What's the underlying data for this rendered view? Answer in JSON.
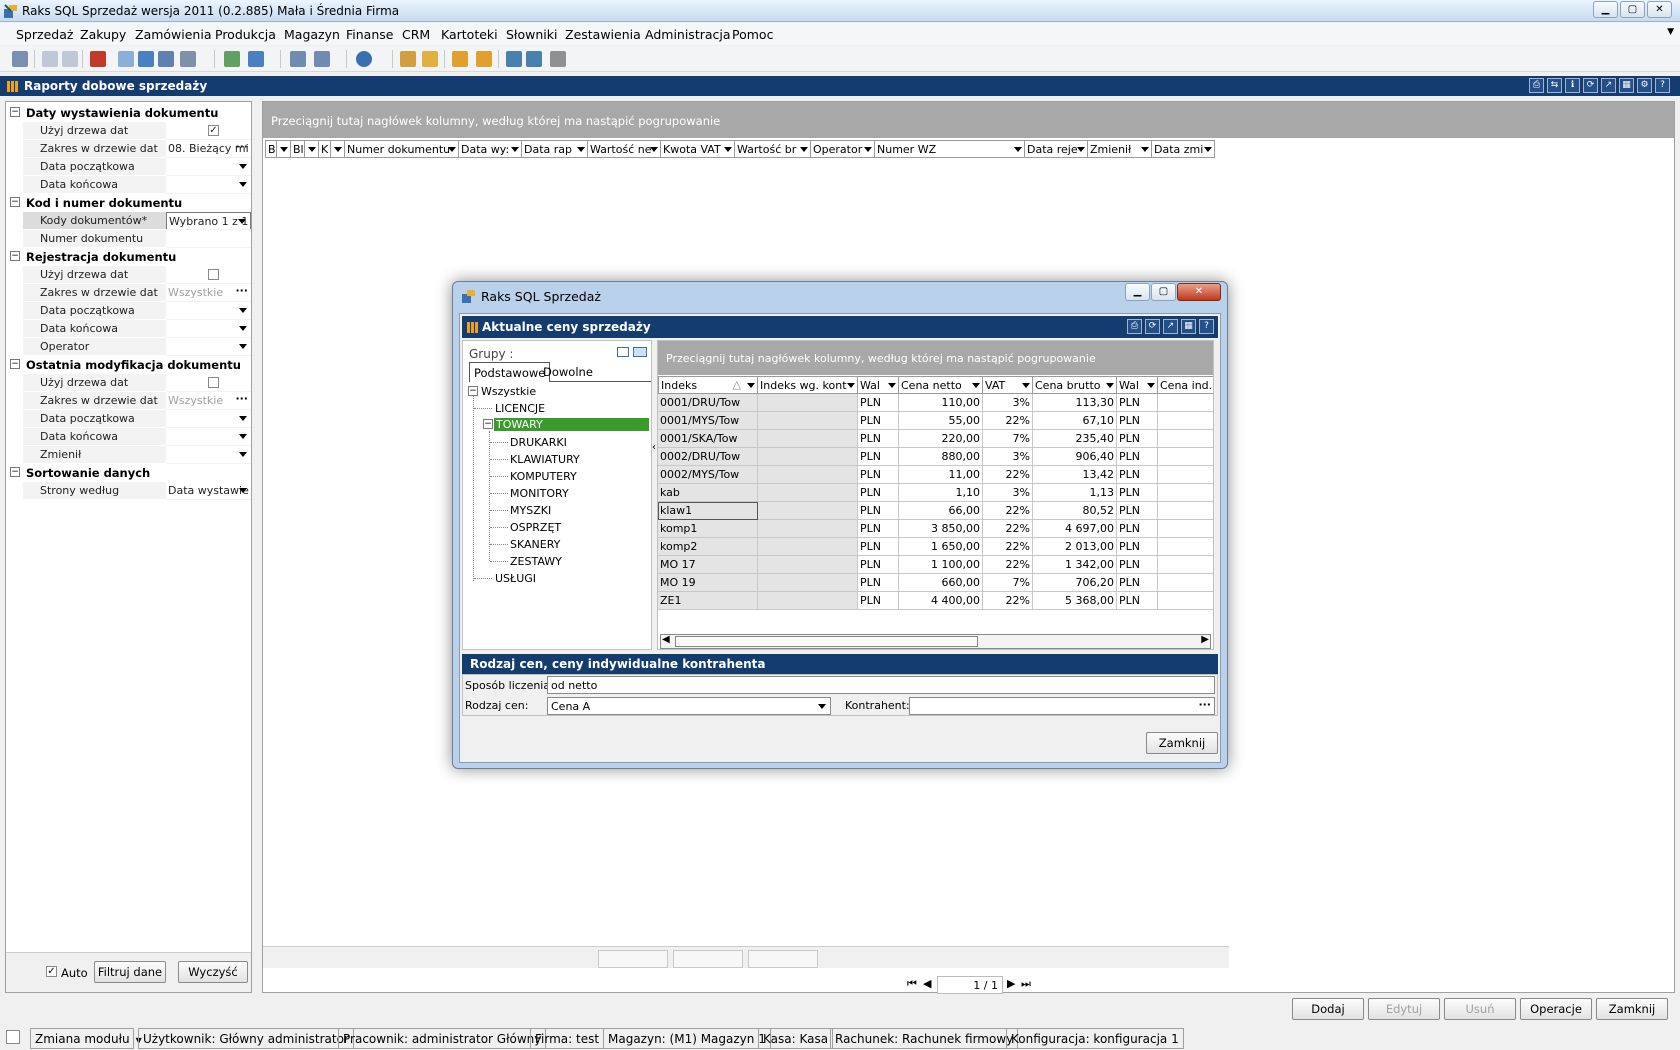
{
  "window": {
    "title": "Raks SQL Sprzedaż wersja 2011 (0.2.885) Mała i Średnia Firma",
    "buttons": [
      "▁",
      "▢",
      "✕"
    ]
  },
  "menu": [
    "Sprzedaż",
    "Zakupy",
    "Zamówienia",
    "Produkcja",
    "Magazyn",
    "Finanse",
    "CRM",
    "Kartoteki",
    "Słowniki",
    "Zestawienia",
    "Administracja",
    "Pomoc"
  ],
  "doc": {
    "title": "Raporty dobowe sprzedaży",
    "icons": [
      "⎙",
      "⇆",
      "ℹ",
      "⟳",
      "↗",
      "▦",
      "⚙",
      "?"
    ]
  },
  "filter": {
    "sections": {
      "s1": "Daty wystawienia dokumentu",
      "s2": "Kod i numer dokumentu",
      "s3": "Rejestracja dokumentu",
      "s4": "Ostatnia modyfikacja dokumentu",
      "s5": "Sortowanie danych"
    },
    "items": {
      "uzyj1": "Użyj drzewa dat",
      "zakres1": "Zakres w drzewie dat",
      "zakres1_val": "08. Bieżący mi",
      "datap1": "Data początkowa",
      "datak1": "Data końcowa",
      "kody": "Kody dokumentów*",
      "kody_val": "Wybrano 1 z 1",
      "numer": "Numer dokumentu",
      "uzyj2": "Użyj drzewa dat",
      "zakres2": "Zakres w drzewie dat",
      "zakres2_val": "Wszystkie",
      "datap2": "Data początkowa",
      "datak2": "Data końcowa",
      "operator": "Operator",
      "uzyj3": "Użyj drzewa dat",
      "zakres3": "Zakres w drzewie dat",
      "zakres3_val": "Wszystkie",
      "datap3": "Data początkowa",
      "datak3": "Data końcowa",
      "zmienil": "Zmienił",
      "strony": "Strony według",
      "strony_val": "Data wystawie"
    },
    "auto_label": "Auto",
    "filtruj_label": "Filtruj dane",
    "wyczysc_label": "Wyczyść"
  },
  "main": {
    "group_hint": "Przeciągnij tutaj nagłówek kolumny, według której ma nastąpić pogrupowanie",
    "columns": [
      "B",
      "Bl",
      "K",
      "Numer dokumentu",
      "Data wy:",
      "Data rap",
      "Wartość ne",
      "Kwota VAT",
      "Wartość br",
      "Operator",
      "Numer WZ",
      "Data reje",
      "Zmienił",
      "Data zmi"
    ],
    "pager": "1 / 1"
  },
  "actions": {
    "dodaj": "Dodaj",
    "edytuj": "Edytuj",
    "usun": "Usuń",
    "operacje": "Operacje",
    "zamknij": "Zamknij"
  },
  "status": {
    "modul": "Zmiana modułu",
    "uzytkownik": "Użytkownik: Główny administrator",
    "pracownik": "Pracownik: administrator Główny",
    "firma": "Firma: test",
    "magazyn": "Magazyn: (M1) Magazyn 1",
    "kasa": "Kasa: Kasa",
    "rachunek": "Rachunek: Rachunek firmowy",
    "konfiguracja": "Konfiguracja: konfiguracja 1"
  },
  "dialog": {
    "title": "Raks SQL Sprzedaż",
    "header": "Aktualne ceny sprzedaży",
    "header_icons": [
      "⎙",
      "⟳",
      "↗",
      "▦",
      "?"
    ],
    "groups_label": "Grupy :",
    "tabs": [
      "Podstawowe",
      "Dowolne"
    ],
    "tree": {
      "root": "Wszystkie",
      "licencje": "LICENCJE",
      "towary": "TOWARY",
      "children": [
        "DRUKARKI",
        "KLAWIATURY",
        "KOMPUTERY",
        "MONITORY",
        "MYSZKI",
        "OSPRZĘT",
        "SKANERY",
        "ZESTAWY"
      ],
      "uslugi": "USŁUGI"
    },
    "group_hint": "Przeciągnij tutaj nagłówek kolumny, według której ma nastąpić pogrupowanie",
    "columns": [
      "Indeks",
      "Indeks wg. kont",
      "Wal",
      "Cena netto",
      "VAT",
      "Cena brutto",
      "Wal",
      "Cena ind."
    ],
    "rows": [
      [
        "0001/DRU/Tow",
        "",
        "PLN",
        "110,00",
        "3%",
        "113,30",
        "PLN",
        ""
      ],
      [
        "0001/MYS/Tow",
        "",
        "PLN",
        "55,00",
        "22%",
        "67,10",
        "PLN",
        ""
      ],
      [
        "0001/SKA/Tow",
        "",
        "PLN",
        "220,00",
        "7%",
        "235,40",
        "PLN",
        ""
      ],
      [
        "0002/DRU/Tow",
        "",
        "PLN",
        "880,00",
        "3%",
        "906,40",
        "PLN",
        ""
      ],
      [
        "0002/MYS/Tow",
        "",
        "PLN",
        "11,00",
        "22%",
        "13,42",
        "PLN",
        ""
      ],
      [
        "kab",
        "",
        "PLN",
        "1,10",
        "3%",
        "1,13",
        "PLN",
        ""
      ],
      [
        "klaw1",
        "",
        "PLN",
        "66,00",
        "22%",
        "80,52",
        "PLN",
        ""
      ],
      [
        "komp1",
        "",
        "PLN",
        "3 850,00",
        "22%",
        "4 697,00",
        "PLN",
        ""
      ],
      [
        "komp2",
        "",
        "PLN",
        "1 650,00",
        "22%",
        "2 013,00",
        "PLN",
        ""
      ],
      [
        "MO 17",
        "",
        "PLN",
        "1 100,00",
        "22%",
        "1 342,00",
        "PLN",
        ""
      ],
      [
        "MO 19",
        "",
        "PLN",
        "660,00",
        "7%",
        "706,20",
        "PLN",
        ""
      ],
      [
        "ZE1",
        "",
        "PLN",
        "4 400,00",
        "22%",
        "5 368,00",
        "PLN",
        ""
      ]
    ],
    "prices_header": "Rodzaj cen, ceny indywidualne kontrahenta",
    "sposob_label": "Sposób liczenia:",
    "sposob_val": "od netto",
    "rodzaj_label": "Rodzaj cen:",
    "rodzaj_val": "Cena A",
    "kontrahent_label": "Kontrahent:",
    "kontrahent_val": "",
    "close_label": "Zamknij"
  }
}
